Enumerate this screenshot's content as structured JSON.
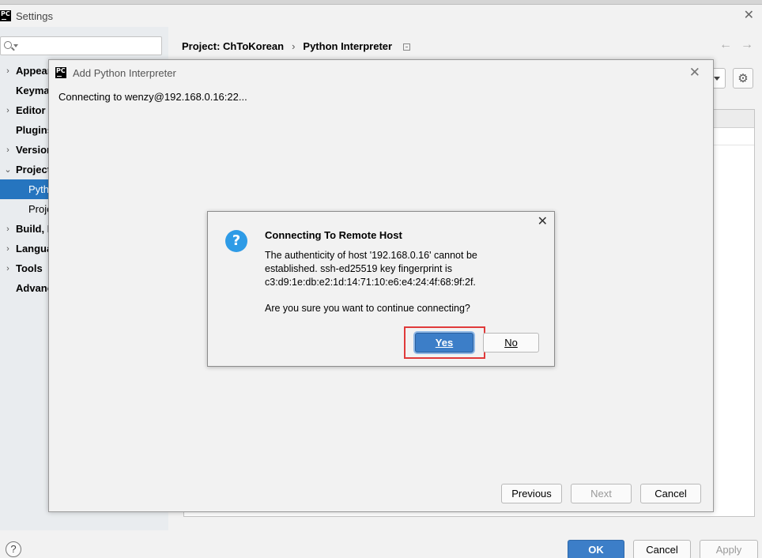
{
  "settings": {
    "title": "Settings",
    "search": {
      "placeholder": ""
    },
    "sidebar": {
      "items": [
        {
          "label": "Appear",
          "expandable": true
        },
        {
          "label": "Keyma",
          "expandable": false
        },
        {
          "label": "Editor",
          "expandable": true
        },
        {
          "label": "Plugins",
          "expandable": false
        },
        {
          "label": "Version",
          "expandable": true
        },
        {
          "label": "Project",
          "expandable": true,
          "expanded": true
        },
        {
          "label": "Pytho",
          "child": true,
          "selected": true
        },
        {
          "label": "Proje",
          "child": true
        },
        {
          "label": "Build, E",
          "expandable": true
        },
        {
          "label": "Langua",
          "expandable": true
        },
        {
          "label": "Tools",
          "expandable": true
        },
        {
          "label": "Advanc",
          "expandable": false
        }
      ]
    },
    "breadcrumb": {
      "project": "Project: ChToKorean",
      "separator": "›",
      "page": "Python Interpreter"
    },
    "buttons": {
      "ok": "OK",
      "cancel": "Cancel",
      "apply": "Apply",
      "help": "?"
    }
  },
  "add_interpreter_dialog": {
    "title": "Add Python Interpreter",
    "status_text": "Connecting to wenzy@192.168.0.16:22...",
    "buttons": {
      "previous": "Previous",
      "next": "Next",
      "cancel": "Cancel"
    }
  },
  "confirm_dialog": {
    "title": "Connecting To Remote Host",
    "message_lines": [
      "The authenticity of host '192.168.0.16' cannot be",
      "established. ssh-ed25519 key fingerprint is",
      "c3:d9:1e:db:e2:1d:14:71:10:e6:e4:24:4f:68:9f:2f."
    ],
    "question": "Are you sure you want to continue connecting?",
    "yes_label": "Yes",
    "no_label": "No",
    "highlight_color": "#e03a3a",
    "accent_color": "#3c7ec8"
  },
  "icons": {
    "app": "pycharm-logo-icon",
    "close": "close-icon",
    "search": "search-icon",
    "question": "question-icon",
    "gear": "gear-icon",
    "back": "arrow-left-icon",
    "forward": "arrow-right-icon"
  }
}
